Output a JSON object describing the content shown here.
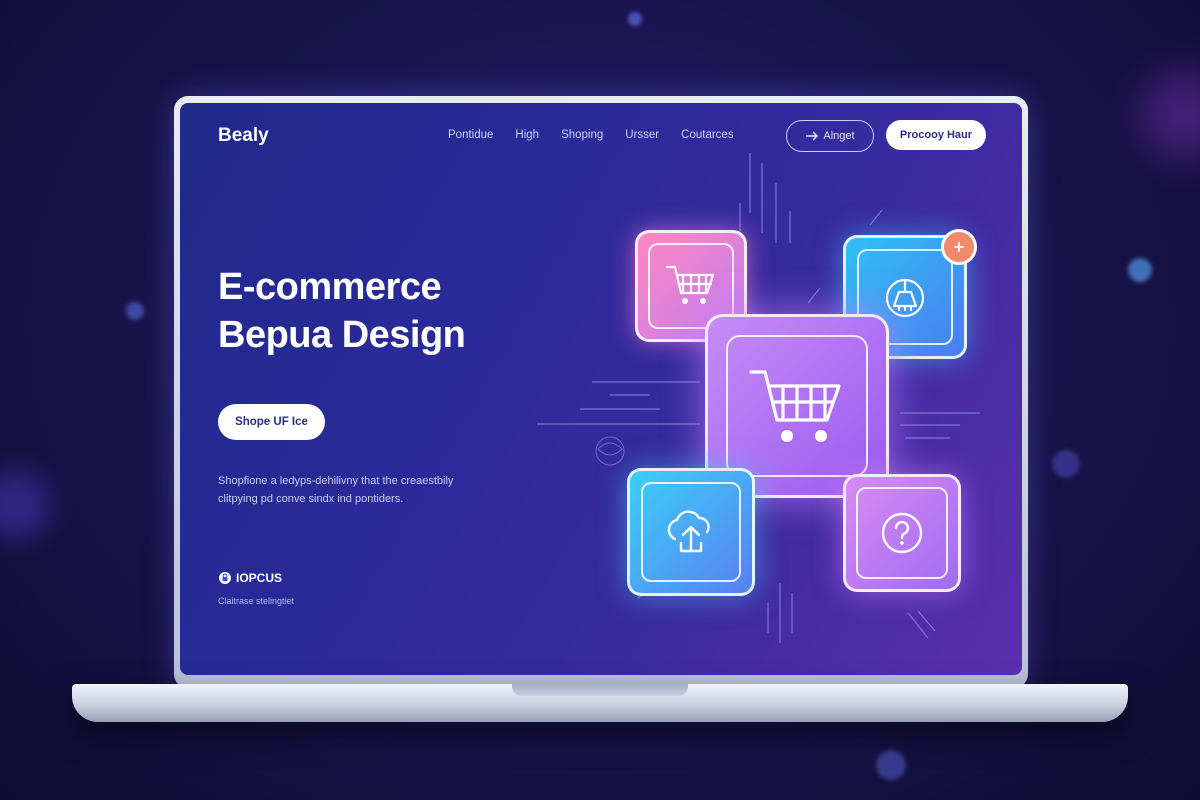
{
  "header": {
    "brand": "Bealy",
    "nav": [
      "Pontidue",
      "High",
      "Shoping",
      "Ursser",
      "Coutarces"
    ],
    "outline_button": "Alnget",
    "solid_button": "Procooy Haur"
  },
  "hero": {
    "title_line1": "E-commerce",
    "title_line2": "Bepua Design",
    "cta": "Shope UF Ice",
    "description_line1": "Shopfione a ledyps-dehilivny that the creaestbily",
    "description_line2": "clitpying pd conve sindx ind pontiders."
  },
  "footer": {
    "logo_text": "IOPCUS",
    "subtext": "Claitrase stelingtiet"
  },
  "icons": [
    "cart-icon",
    "broom-icon",
    "cart-icon",
    "upload-icon",
    "question-icon",
    "plus-icon",
    "lock-icon"
  ],
  "colors": {
    "screen_gradient": [
      "#1f2a88",
      "#5b2fb0"
    ],
    "tile_pink": "#e98ad6",
    "tile_blue": "#33b6f0",
    "tile_purple": "#b46df0",
    "badge": "#f08a6a"
  }
}
